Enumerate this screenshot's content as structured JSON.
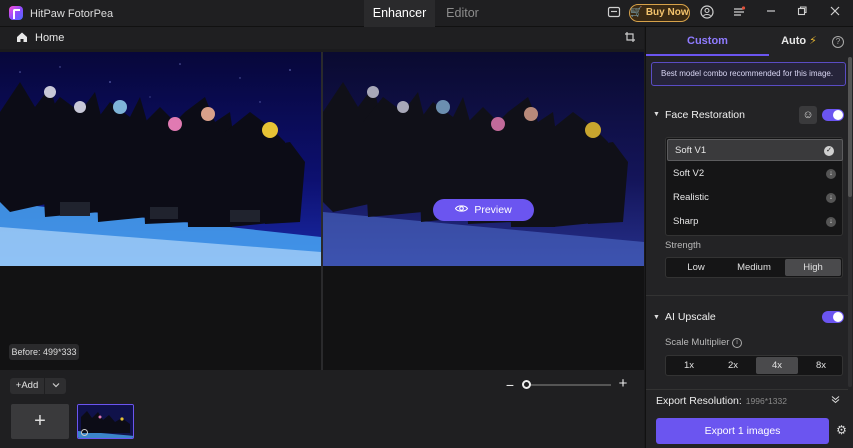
{
  "app": {
    "title": "HitPaw FotorPea"
  },
  "header": {
    "tabs": [
      {
        "label": "Enhancer",
        "active": true
      },
      {
        "label": "Editor",
        "active": false
      }
    ],
    "buy_label": "Buy Now",
    "icons": [
      "gallery-icon",
      "cart-icon",
      "account-icon",
      "menu-icon",
      "minimize-icon",
      "maximize-icon",
      "close-icon"
    ]
  },
  "subbar": {
    "home_label": "Home"
  },
  "canvas": {
    "preview_label": "Preview",
    "before_badge": "Before: 499*333"
  },
  "bottom": {
    "add_label": "Add",
    "add_tile": "+",
    "zoom_out": "−",
    "zoom_in": "+",
    "zoom_level": 0.0
  },
  "panel": {
    "tabs": [
      {
        "label": "Custom",
        "active": true
      },
      {
        "label": "Auto",
        "active": false
      }
    ],
    "recommendation": "Best model combo recommended for this image.",
    "face_restoration": {
      "title": "Face Restoration",
      "enabled": true,
      "models": [
        {
          "label": "Soft V1",
          "selected": true
        },
        {
          "label": "Soft V2",
          "selected": false
        },
        {
          "label": "Realistic",
          "selected": false
        },
        {
          "label": "Sharp",
          "selected": false
        }
      ],
      "strength_label": "Strength",
      "strength_options": [
        "Low",
        "Medium",
        "High"
      ],
      "strength_selected": "High"
    },
    "ai_upscale": {
      "title": "AI Upscale",
      "enabled": true,
      "scale_label": "Scale Multiplier",
      "scale_options": [
        "1x",
        "2x",
        "4x",
        "8x"
      ],
      "scale_selected": "4x"
    },
    "export": {
      "resolution_label": "Export Resolution:",
      "resolution_value": "1996*1332",
      "button_label": "Export 1 images"
    }
  },
  "colors": {
    "accent": "#6b55f0",
    "buy_gold": "#d7a24a",
    "background": "#1b1b1d"
  }
}
